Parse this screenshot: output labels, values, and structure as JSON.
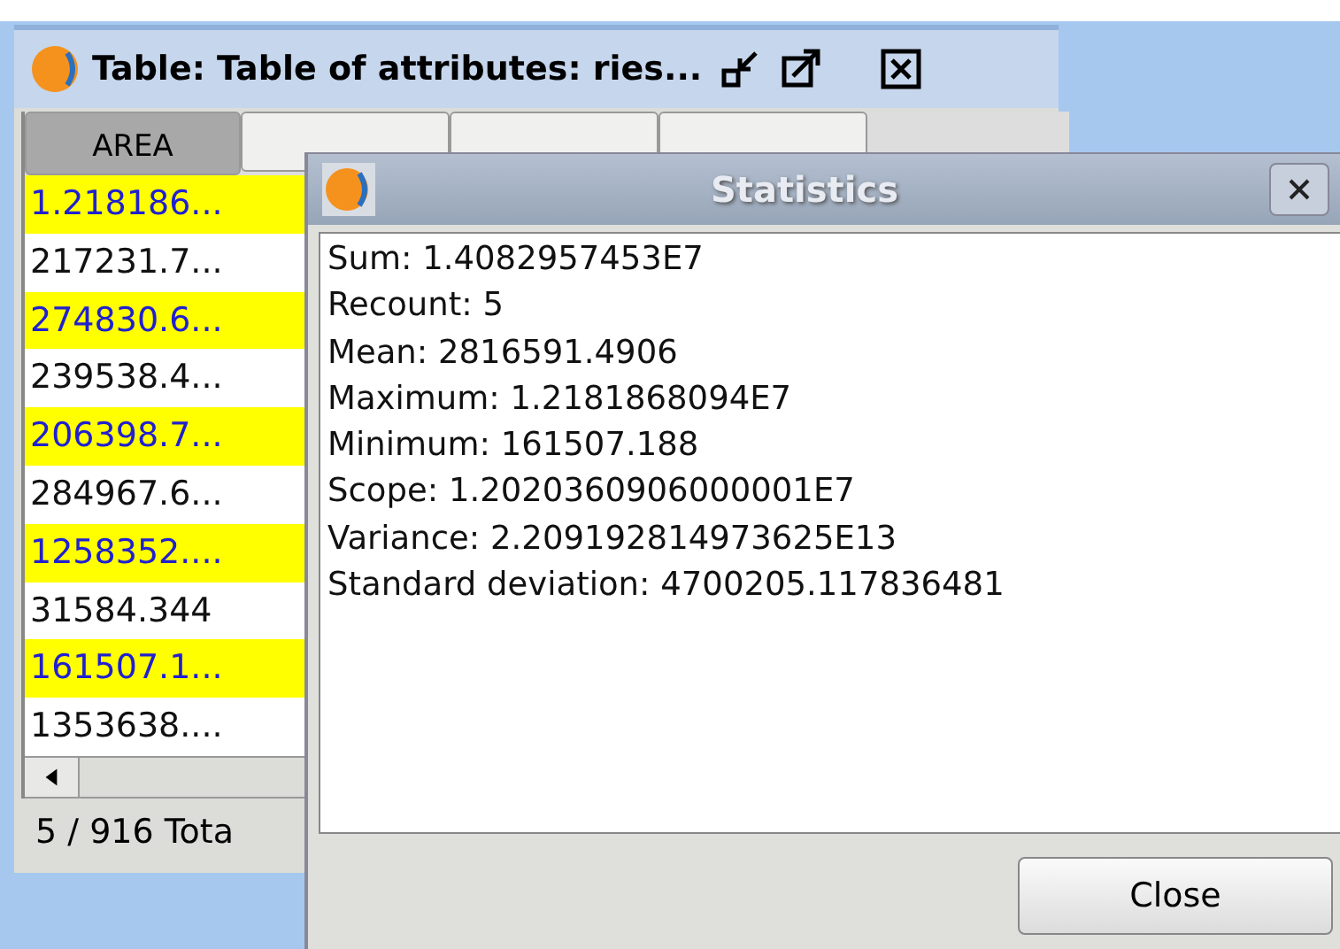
{
  "table_window": {
    "title": "Table: Table of attributes: ries...",
    "columns": [
      {
        "label": "AREA",
        "selected": true
      }
    ],
    "rows": [
      {
        "area": "1.218186...",
        "selected": true
      },
      {
        "area": "217231.7...",
        "selected": false
      },
      {
        "area": "274830.6...",
        "selected": true
      },
      {
        "area": "239538.4...",
        "selected": false
      },
      {
        "area": "206398.7...",
        "selected": true
      },
      {
        "area": "284967.6...",
        "selected": false
      },
      {
        "area": "1258352....",
        "selected": true
      },
      {
        "area": "31584.344",
        "selected": false
      },
      {
        "area": "161507.1...",
        "selected": true
      },
      {
        "area": "1353638....",
        "selected": false
      }
    ],
    "status_bar": "5 / 916 Tota"
  },
  "dialog": {
    "title": "Statistics",
    "lines": [
      "Sum: 1.4082957453E7",
      "Recount: 5",
      "Mean: 2816591.4906",
      "Maximum: 1.2181868094E7",
      "Minimum: 161507.188",
      "Scope: 1.2020360906000001E7",
      "Variance: 2.209192814973625E13",
      "Standard deviation: 4700205.117836481"
    ],
    "buttons": [
      "Close"
    ]
  }
}
